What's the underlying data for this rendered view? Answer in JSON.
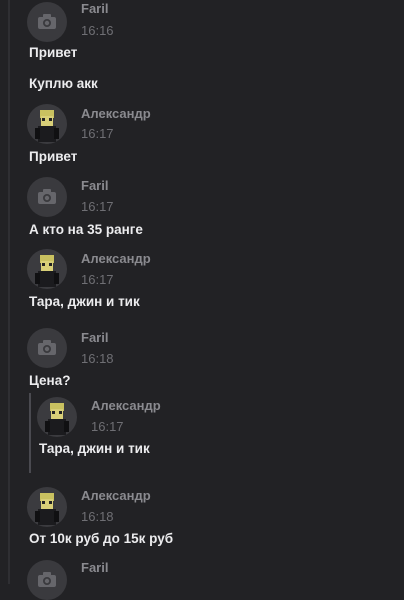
{
  "messages": [
    {
      "author": "Faril",
      "time": "16:16",
      "lines": [
        "Привет",
        "Куплю акк"
      ]
    },
    {
      "author": "Александр",
      "time": "16:17",
      "lines": [
        "Привет"
      ]
    },
    {
      "author": "Faril",
      "time": "16:17",
      "lines": [
        "А кто на 35 ранге"
      ]
    },
    {
      "author": "Александр",
      "time": "16:17",
      "lines": [
        "Тара, джин и тик"
      ]
    },
    {
      "author": "Faril",
      "time": "16:18",
      "lines": [
        "Цена?"
      ]
    },
    {
      "author": "Александр",
      "time": "16:18",
      "lines": [
        "От 10к руб до 15к руб"
      ]
    },
    {
      "author": "Faril",
      "time": "",
      "lines": []
    }
  ],
  "quote": {
    "author": "Александр",
    "time": "16:17",
    "text": "Тара, джин и тик"
  },
  "icons": {
    "faril_avatar": "camera-icon",
    "alexandr_avatar": "character-avatar"
  },
  "colors": {
    "background": "#222225",
    "text": "#ececee",
    "author": "#8a8a8f",
    "time": "#6f6f74"
  }
}
